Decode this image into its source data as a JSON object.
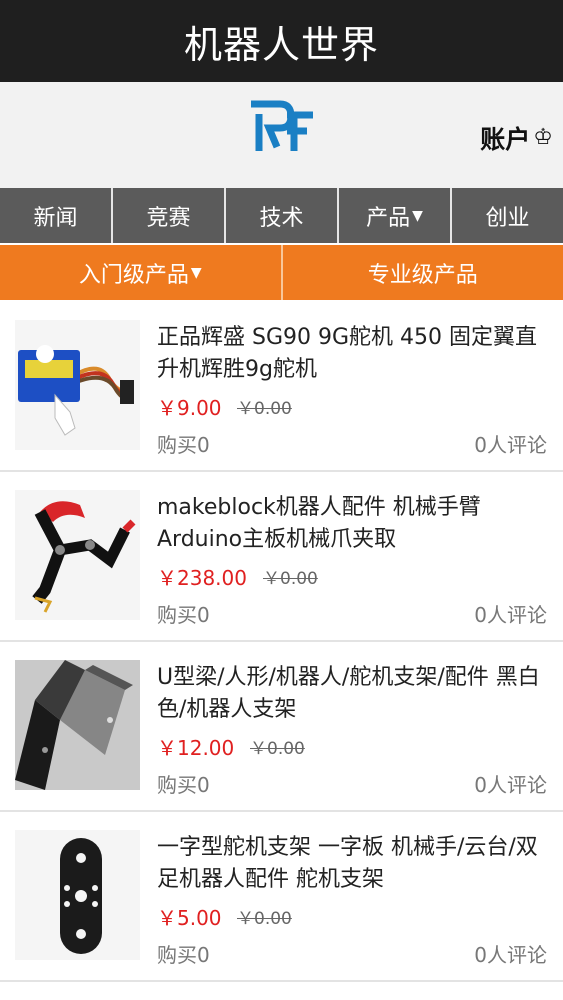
{
  "app_title": "机器人世界",
  "header": {
    "account_label": "账户",
    "account_icon": "crown-icon",
    "logo": "RF"
  },
  "nav": {
    "items": [
      {
        "label": "新闻"
      },
      {
        "label": "竞赛"
      },
      {
        "label": "技术"
      },
      {
        "label": "产品"
      },
      {
        "label": "创业"
      }
    ],
    "dropdown_item_index": 3
  },
  "subnav": {
    "items": [
      {
        "label": "入门级产品"
      },
      {
        "label": "专业级产品"
      }
    ],
    "dropdown_item_index": 0
  },
  "colors": {
    "titlebar": "#1f1f1f",
    "nav": "#5b5b5b",
    "subnav": "#ef7a1f",
    "price": "#e02020"
  },
  "products": [
    {
      "name": "正品辉盛 SG90 9G舵机 450 固定翼直升机辉胜9g舵机",
      "price": "￥9.00",
      "old_price": "￥0.00",
      "sold": "购买0",
      "comments": "0人评论"
    },
    {
      "name": "makeblock机器人配件 机械手臂Arduino主板机械爪夹取",
      "price": "￥238.00",
      "old_price": "￥0.00",
      "sold": "购买0",
      "comments": "0人评论"
    },
    {
      "name": "U型梁/人形/机器人/舵机支架/配件 黑白色/机器人支架",
      "price": "￥12.00",
      "old_price": "￥0.00",
      "sold": "购买0",
      "comments": "0人评论"
    },
    {
      "name": "一字型舵机支架 一字板 机械手/云台/双足机器人配件 舵机支架",
      "price": "￥5.00",
      "old_price": "￥0.00",
      "sold": "购买0",
      "comments": "0人评论"
    }
  ]
}
